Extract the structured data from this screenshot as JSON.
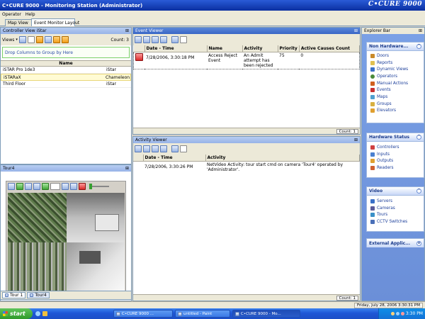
{
  "window": {
    "title": "C•CURE 9000 - Monitoring Station (Administrator)",
    "brand": "C•CURE 9000"
  },
  "menu": [
    "Operator",
    "Help"
  ],
  "top_tabs": [
    {
      "label": "Map View"
    },
    {
      "label": "Event Monitor Layout"
    }
  ],
  "controller_view": {
    "title": "Controller View iStar",
    "views_label": "Views",
    "count": "Count: 3",
    "group_hint": "Drop Columns to Group by Here",
    "column": "Name",
    "rows": [
      {
        "name": "iSTAR Pro 1de3",
        "type": "iStar"
      },
      {
        "name": "iSTARaX",
        "type": "Chameleon"
      },
      {
        "name": "Third Floor",
        "type": "iStar"
      }
    ]
  },
  "tour": {
    "title": "Tour4",
    "tabs": [
      "Tour 1",
      "Tour4"
    ]
  },
  "event_viewer": {
    "title": "Event Viewer",
    "columns": [
      "Date - Time",
      "Name",
      "Activity",
      "Priority",
      "Active Causes Count"
    ],
    "rows": [
      {
        "datetime": "7/28/2006, 3:30:18 PM",
        "name": "Access Reject Event",
        "activity": "An Admit attempt has been rejected",
        "priority": "75",
        "count": "0"
      }
    ],
    "status_count": "Count: 1"
  },
  "activity_viewer": {
    "title": "Activity Viewer",
    "columns": [
      "Date - Time",
      "Activity"
    ],
    "rows": [
      {
        "datetime": "7/28/2006, 3:30:26 PM",
        "activity": "NetVideo Activity: tour start cmd on camera 'Tour4' operated by 'Administrator'."
      }
    ],
    "status_count": "Count: 1"
  },
  "explorer": {
    "title": "Explorer Bar",
    "groups": [
      {
        "title": "Non Hardware...",
        "items": [
          "Doors",
          "Reports",
          "Dynamic Views",
          "Operators",
          "Manual Actions",
          "Events",
          "Maps",
          "Groups",
          "Elevators"
        ]
      },
      {
        "title": "Hardware Status",
        "items": [
          "Controllers",
          "Inputs",
          "Outputs",
          "Readers"
        ]
      },
      {
        "title": "Video",
        "items": [
          "Servers",
          "Cameras",
          "Tours",
          "CCTV Switches"
        ]
      },
      {
        "title": "External Applic...",
        "items": []
      }
    ]
  },
  "status_time": "Friday, July 28, 2006 3:30:31 PM",
  "taskbar": {
    "start": "start",
    "buttons": [
      "C•CURE 9000 ...",
      "untitled - Paint",
      "C•CURE 9000 - Mo..."
    ],
    "clock": "3:30 PM"
  }
}
